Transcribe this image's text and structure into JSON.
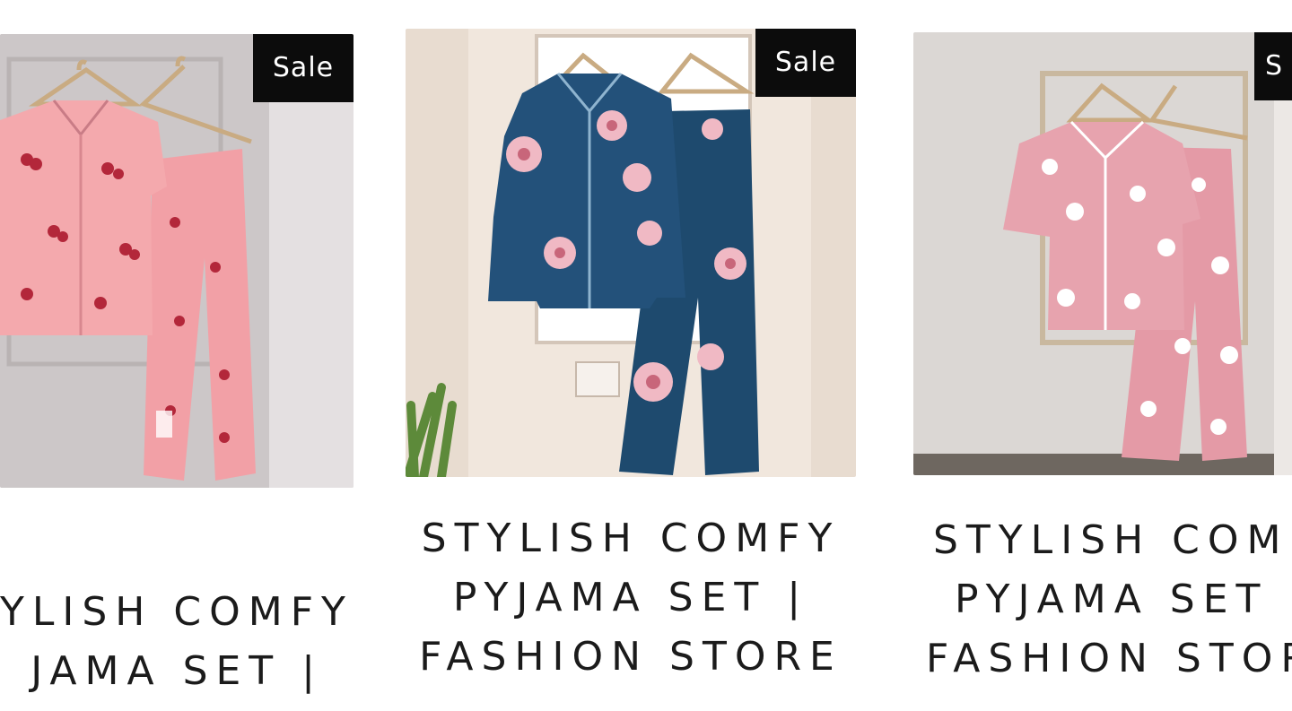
{
  "products": [
    {
      "sale_badge": "Sale",
      "image_alt": "Pink cherry print pyjama set on hangers",
      "title_lines": [
        "YLISH COMFY",
        "JAMA SET |"
      ],
      "colors": {
        "garment": "#f2a0a6",
        "print": "#b3273a"
      }
    },
    {
      "sale_badge": "Sale",
      "image_alt": "Navy floral satin pyjama set on hangers",
      "title_lines": [
        "STYLISH COMFY",
        "PYJAMA SET |",
        "FASHION STORE"
      ],
      "colors": {
        "garment": "#1e4a6e",
        "print": "#f0b9c4"
      }
    },
    {
      "sale_badge": "S",
      "image_alt": "Pink heart print short sleeve pyjama set on hangers",
      "title_lines": [
        "STYLISH COMF",
        "PYJAMA SET",
        "FASHION STOR"
      ],
      "colors": {
        "garment": "#e7a3ae",
        "print": "#ffffff"
      }
    }
  ]
}
